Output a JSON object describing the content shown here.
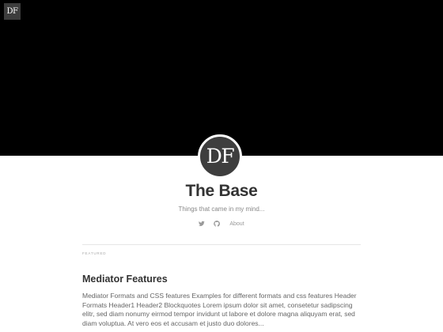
{
  "header": {
    "corner_logo": "DF",
    "avatar_initials": "DF",
    "site_title": "The Base",
    "site_description": "Things that came in my mind...",
    "social": {
      "twitter_icon": "twitter-icon",
      "github_icon": "github-icon",
      "about_label": "About"
    }
  },
  "main": {
    "section_label": "FEATURED",
    "posts": [
      {
        "title": "Mediator Features",
        "excerpt": "Mediator Formats and CSS features Examples for different formats and css features Header Formats Header1 Header2 Blockquotes Lorem ipsum dolor sit amet, consetetur sadipscing elitr, sed diam nonumy eirmod tempor invidunt ut labore et dolore magna aliquyam erat, sed diam voluptua. At vero eos et accusam et justo duo dolores..."
      }
    ]
  },
  "colors": {
    "hero_background": "#000000",
    "avatar_background": "#3e3e3e",
    "text_primary": "#333333",
    "text_muted": "#888888"
  }
}
